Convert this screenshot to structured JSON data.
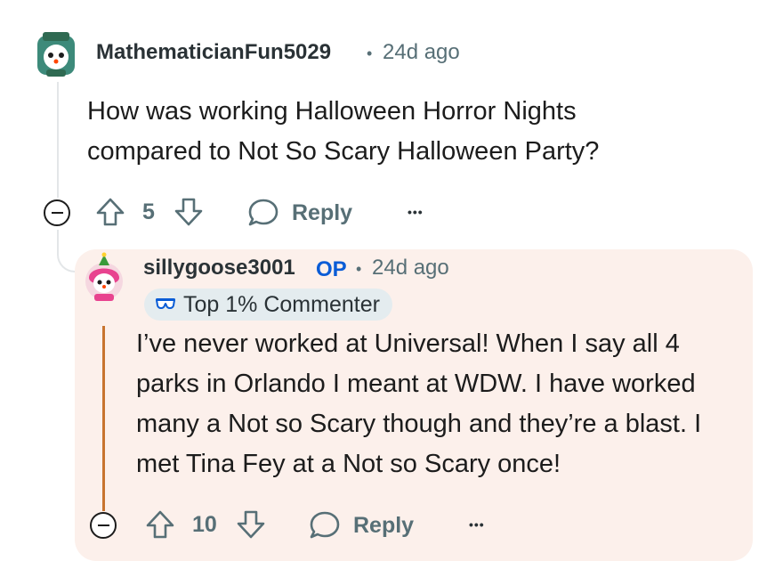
{
  "comment": {
    "username": "MathematicianFun5029",
    "separator": "•",
    "time": "24d ago",
    "body_line1": "How was working Halloween Horror Nights",
    "body_line2": "compared to Not So Scary Halloween Party?",
    "score": "5",
    "reply_label": "Reply",
    "more_label": "•••"
  },
  "reply": {
    "username": "sillygoose3001",
    "op_badge": "OP",
    "separator": "•",
    "time": "24d ago",
    "flair": "Top 1% Commenter",
    "body_line1": "I’ve never worked at Universal! When I say all 4",
    "body_line2": "parks in Orlando I meant at WDW. I have worked",
    "body_line3": "many a Not so Scary though and they’re a blast. I",
    "body_line4": "met Tina Fey at a Not so Scary once!",
    "score": "10",
    "reply_label": "Reply",
    "more_label": "•••"
  },
  "colors": {
    "highlight_bg": "#fcf0eb",
    "op_badge": "#0a5cd6",
    "meta_text": "#576f76",
    "thread_accent": "#c8742f"
  }
}
